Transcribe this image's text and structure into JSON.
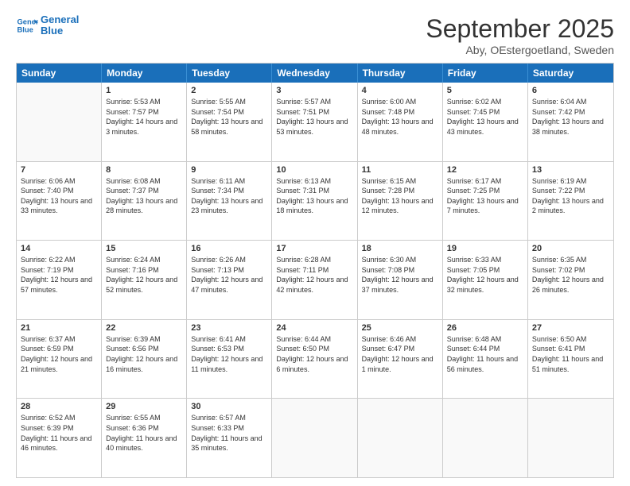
{
  "logo": {
    "line1": "General",
    "line2": "Blue"
  },
  "title": "September 2025",
  "subtitle": "Aby, OEstergoetland, Sweden",
  "header": {
    "days": [
      "Sunday",
      "Monday",
      "Tuesday",
      "Wednesday",
      "Thursday",
      "Friday",
      "Saturday"
    ]
  },
  "weeks": [
    [
      {
        "day": "",
        "empty": true
      },
      {
        "day": "1",
        "rise": "5:53 AM",
        "set": "7:57 PM",
        "daylight": "14 hours and 3 minutes."
      },
      {
        "day": "2",
        "rise": "5:55 AM",
        "set": "7:54 PM",
        "daylight": "13 hours and 58 minutes."
      },
      {
        "day": "3",
        "rise": "5:57 AM",
        "set": "7:51 PM",
        "daylight": "13 hours and 53 minutes."
      },
      {
        "day": "4",
        "rise": "6:00 AM",
        "set": "7:48 PM",
        "daylight": "13 hours and 48 minutes."
      },
      {
        "day": "5",
        "rise": "6:02 AM",
        "set": "7:45 PM",
        "daylight": "13 hours and 43 minutes."
      },
      {
        "day": "6",
        "rise": "6:04 AM",
        "set": "7:42 PM",
        "daylight": "13 hours and 38 minutes."
      }
    ],
    [
      {
        "day": "7",
        "rise": "6:06 AM",
        "set": "7:40 PM",
        "daylight": "13 hours and 33 minutes."
      },
      {
        "day": "8",
        "rise": "6:08 AM",
        "set": "7:37 PM",
        "daylight": "13 hours and 28 minutes."
      },
      {
        "day": "9",
        "rise": "6:11 AM",
        "set": "7:34 PM",
        "daylight": "13 hours and 23 minutes."
      },
      {
        "day": "10",
        "rise": "6:13 AM",
        "set": "7:31 PM",
        "daylight": "13 hours and 18 minutes."
      },
      {
        "day": "11",
        "rise": "6:15 AM",
        "set": "7:28 PM",
        "daylight": "13 hours and 12 minutes."
      },
      {
        "day": "12",
        "rise": "6:17 AM",
        "set": "7:25 PM",
        "daylight": "13 hours and 7 minutes."
      },
      {
        "day": "13",
        "rise": "6:19 AM",
        "set": "7:22 PM",
        "daylight": "13 hours and 2 minutes."
      }
    ],
    [
      {
        "day": "14",
        "rise": "6:22 AM",
        "set": "7:19 PM",
        "daylight": "12 hours and 57 minutes."
      },
      {
        "day": "15",
        "rise": "6:24 AM",
        "set": "7:16 PM",
        "daylight": "12 hours and 52 minutes."
      },
      {
        "day": "16",
        "rise": "6:26 AM",
        "set": "7:13 PM",
        "daylight": "12 hours and 47 minutes."
      },
      {
        "day": "17",
        "rise": "6:28 AM",
        "set": "7:11 PM",
        "daylight": "12 hours and 42 minutes."
      },
      {
        "day": "18",
        "rise": "6:30 AM",
        "set": "7:08 PM",
        "daylight": "12 hours and 37 minutes."
      },
      {
        "day": "19",
        "rise": "6:33 AM",
        "set": "7:05 PM",
        "daylight": "12 hours and 32 minutes."
      },
      {
        "day": "20",
        "rise": "6:35 AM",
        "set": "7:02 PM",
        "daylight": "12 hours and 26 minutes."
      }
    ],
    [
      {
        "day": "21",
        "rise": "6:37 AM",
        "set": "6:59 PM",
        "daylight": "12 hours and 21 minutes."
      },
      {
        "day": "22",
        "rise": "6:39 AM",
        "set": "6:56 PM",
        "daylight": "12 hours and 16 minutes."
      },
      {
        "day": "23",
        "rise": "6:41 AM",
        "set": "6:53 PM",
        "daylight": "12 hours and 11 minutes."
      },
      {
        "day": "24",
        "rise": "6:44 AM",
        "set": "6:50 PM",
        "daylight": "12 hours and 6 minutes."
      },
      {
        "day": "25",
        "rise": "6:46 AM",
        "set": "6:47 PM",
        "daylight": "12 hours and 1 minute."
      },
      {
        "day": "26",
        "rise": "6:48 AM",
        "set": "6:44 PM",
        "daylight": "11 hours and 56 minutes."
      },
      {
        "day": "27",
        "rise": "6:50 AM",
        "set": "6:41 PM",
        "daylight": "11 hours and 51 minutes."
      }
    ],
    [
      {
        "day": "28",
        "rise": "6:52 AM",
        "set": "6:39 PM",
        "daylight": "11 hours and 46 minutes."
      },
      {
        "day": "29",
        "rise": "6:55 AM",
        "set": "6:36 PM",
        "daylight": "11 hours and 40 minutes."
      },
      {
        "day": "30",
        "rise": "6:57 AM",
        "set": "6:33 PM",
        "daylight": "11 hours and 35 minutes."
      },
      {
        "day": "",
        "empty": true
      },
      {
        "day": "",
        "empty": true
      },
      {
        "day": "",
        "empty": true
      },
      {
        "day": "",
        "empty": true
      }
    ]
  ]
}
